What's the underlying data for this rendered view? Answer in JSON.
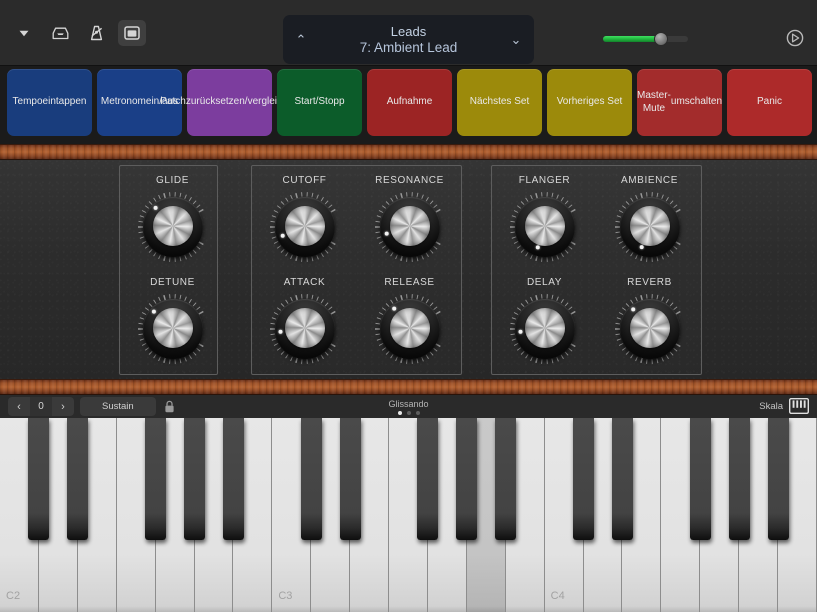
{
  "topbar": {
    "icons": [
      {
        "name": "chevron-down-icon",
        "label": "▼"
      },
      {
        "name": "inbox-tray-icon",
        "label": "inbox"
      },
      {
        "name": "metronome-icon",
        "label": "metronome"
      },
      {
        "name": "window-layout-icon",
        "label": "layout"
      }
    ],
    "patch": {
      "category": "Leads",
      "name": "7: Ambient Lead",
      "up_chevron": "⌃",
      "down_chevron": "⌄"
    },
    "volume": {
      "value": 68,
      "fill_color": "#1fb33c"
    },
    "tuner_icon": "tuner-icon"
  },
  "action_buttons": [
    {
      "label": "Tempo\neintappen",
      "color": "#193d7d"
    },
    {
      "label": "Metronom\nein/aus",
      "color": "#1a3f87"
    },
    {
      "label": "Patch\nzurücksetzen/\nvergleichen",
      "color": "#7c3d9e"
    },
    {
      "label": "Start/Stopp",
      "color": "#0c5c2a"
    },
    {
      "label": "Aufnahme",
      "color": "#9c2424"
    },
    {
      "label": "Nächstes Set",
      "color": "#9c8a0b"
    },
    {
      "label": "Vorheriges Set",
      "color": "#9c8a0b"
    },
    {
      "label": "Master-Mute\numschalten",
      "color": "#a32c2c"
    },
    {
      "label": "Panic",
      "color": "#ad2a2a"
    }
  ],
  "page_dots": {
    "count": 2,
    "active": 0
  },
  "synth": {
    "groups": [
      {
        "id": "group-glide",
        "knobs": [
          {
            "label": "GLIDE",
            "angle": 318,
            "col": 0,
            "row": 0
          },
          {
            "label": "DETUNE",
            "angle": 312,
            "col": 0,
            "row": 1
          }
        ]
      },
      {
        "id": "group-filter",
        "knobs": [
          {
            "label": "CUTOFF",
            "angle": 242,
            "col": 0,
            "row": 0
          },
          {
            "label": "RESONANCE",
            "angle": 248,
            "col": 1,
            "row": 0
          },
          {
            "label": "ATTACK",
            "angle": 258,
            "col": 0,
            "row": 1
          },
          {
            "label": "RELEASE",
            "angle": 323,
            "col": 1,
            "row": 1
          }
        ]
      },
      {
        "id": "group-effects",
        "knobs": [
          {
            "label": "FLANGER",
            "angle": 193,
            "col": 0,
            "row": 0
          },
          {
            "label": "AMBIENCE",
            "angle": 196,
            "col": 1,
            "row": 0
          },
          {
            "label": "DELAY",
            "angle": 258,
            "col": 0,
            "row": 1
          },
          {
            "label": "REVERB",
            "angle": 320,
            "col": 1,
            "row": 1
          }
        ]
      }
    ]
  },
  "keyboard_toolbar": {
    "prev_label": "‹",
    "octave_value": "0",
    "next_label": "›",
    "sustain_label": "Sustain",
    "lock_icon": "lock-icon",
    "glissando_label": "Glissando",
    "glissando_dots": {
      "count": 3,
      "active": 0
    },
    "scale_label": "Skala",
    "scale_icon": "piano-keys-icon"
  },
  "piano": {
    "octave_labels": [
      "C2",
      "C3",
      "C4"
    ],
    "white_key_count": 21,
    "pressed_white_key_index": 12,
    "black_key_pattern": [
      0,
      1,
      3,
      4,
      5
    ]
  }
}
